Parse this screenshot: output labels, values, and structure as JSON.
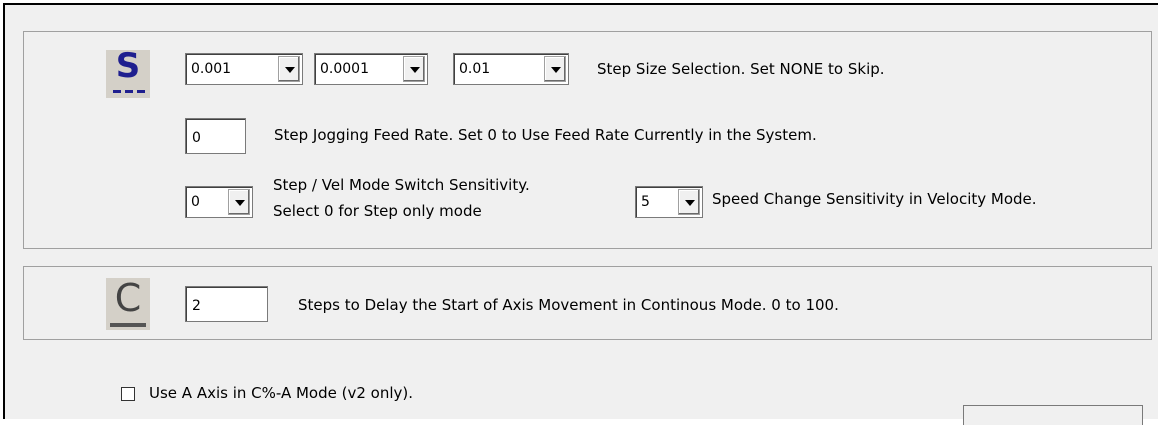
{
  "step_group": {
    "icon_letter": "S",
    "step_size_1": "0.001",
    "step_size_2": "0.0001",
    "step_size_3": "0.01",
    "step_size_label": "Step Size Selection. Set NONE to Skip.",
    "feed_rate_value": "0",
    "feed_rate_label": "Step Jogging Feed Rate. Set 0 to Use Feed Rate Currently in the System.",
    "mode_switch_value": "0",
    "mode_switch_label_line1": "Step / Vel  Mode Switch Sensitivity.",
    "mode_switch_label_line2": "Select 0 for Step only mode",
    "speed_change_value": "5",
    "speed_change_label": "Speed Change Sensitivity in Velocity Mode."
  },
  "continuous_group": {
    "icon_letter": "C",
    "delay_value": "2",
    "delay_label": "Steps to Delay the Start of Axis Movement in Continous Mode. 0 to 100."
  },
  "a_axis": {
    "checkbox_label": "Use A Axis in C%-A Mode (v2 only).",
    "checked": false
  },
  "icons": [
    "step-mode-icon",
    "continuous-mode-icon",
    "dropdown-arrow-icon"
  ]
}
